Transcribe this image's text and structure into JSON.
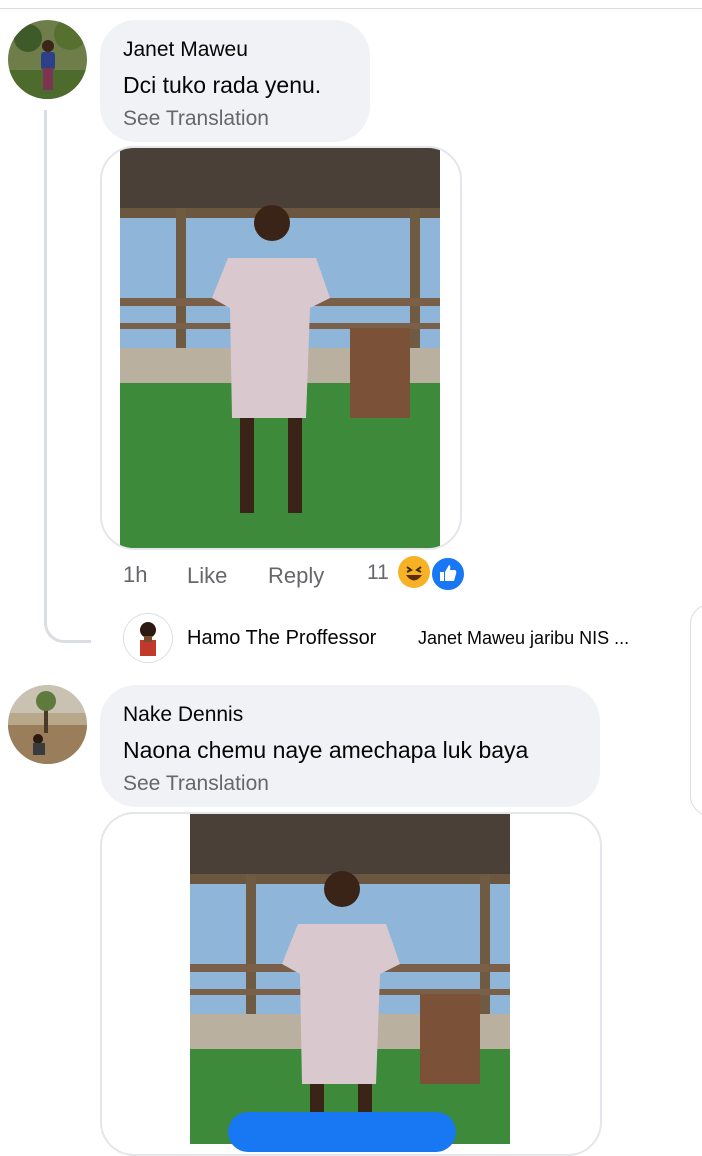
{
  "comments": [
    {
      "author": "Janet Maweu",
      "text": "Dci tuko rada yenu.",
      "translate": "See Translation",
      "time": "1h",
      "like_label": "Like",
      "reply_label": "Reply",
      "reaction_count": "11"
    },
    {
      "author": "Nake Dennis",
      "text": "Naona chemu naye amechapa luk baya",
      "translate": "See Translation"
    }
  ],
  "reply": {
    "author": "Hamo The Proffessor",
    "snippet": "Janet Maweu jaribu NIS ..."
  },
  "icons": {
    "haha": "haha-reaction-icon",
    "like": "like-reaction-icon"
  },
  "colors": {
    "bubble": "#f0f2f5",
    "secondary_text": "#65676b",
    "like_blue": "#1877f2",
    "haha_yellow": "#f7b125"
  }
}
